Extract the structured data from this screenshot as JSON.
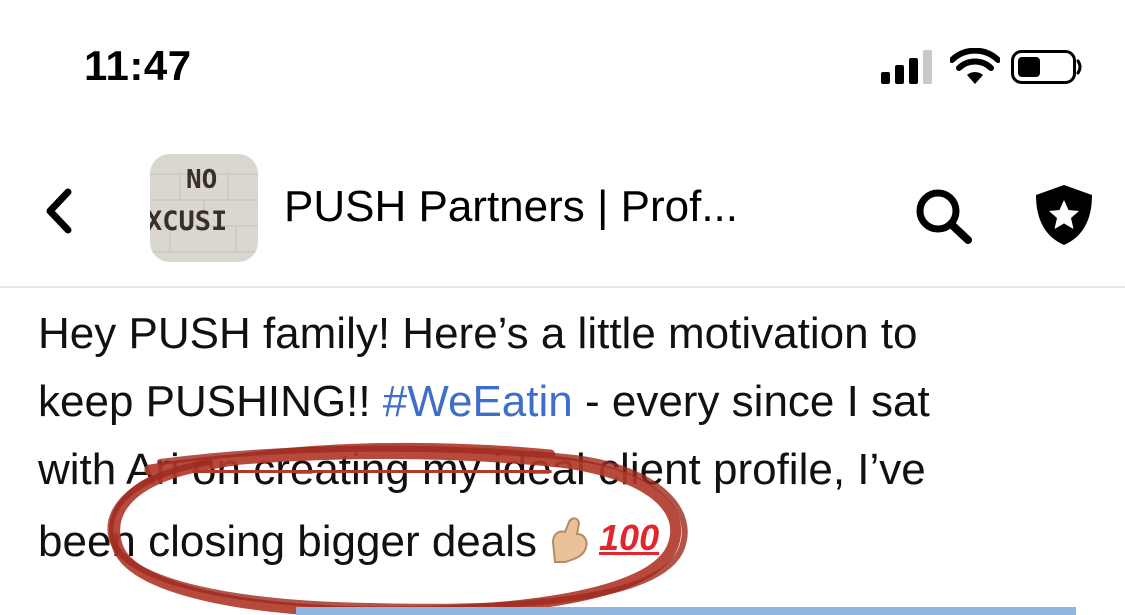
{
  "status_bar": {
    "time": "11:47",
    "icons": [
      "signal-icon",
      "wifi-icon",
      "battery-icon"
    ]
  },
  "header": {
    "back_icon": "chevron-left-icon",
    "avatar_text_top": "NO",
    "avatar_text_bottom": "XCUSI",
    "title": "PUSH Partners | Prof...",
    "actions": [
      "search-icon",
      "shield-star-icon"
    ]
  },
  "post": {
    "line1": "Hey PUSH family! Here’s a little motivation to",
    "line2_start": "keep PUSHING!! ",
    "hashtag": "#WeEatin",
    "line2_end": " - every since I sat",
    "line3_start": "with Ari ",
    "line3_struck": "on creating my ide",
    "line3_end": "al client profile, I’ve",
    "line4": "been closing bigger deals",
    "emoji_flex": "flexed-biceps-emoji",
    "emoji_100": "100"
  },
  "colors": {
    "hashtag": "#3d6fc9",
    "annotation_marker": "#b23a2c",
    "text": "#111111"
  }
}
